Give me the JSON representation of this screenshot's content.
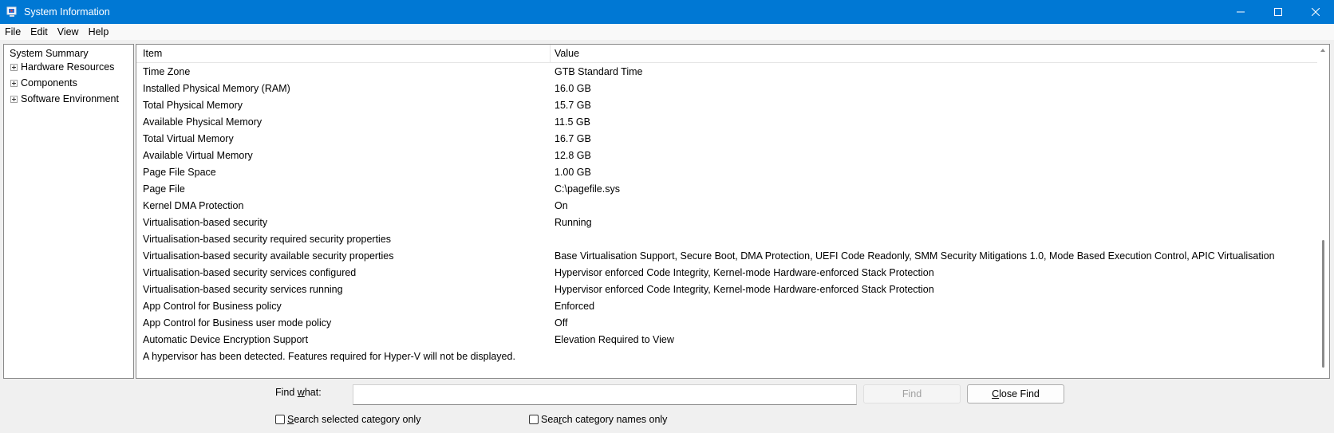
{
  "window": {
    "title": "System Information",
    "controls": {
      "minimize": "—",
      "maximize": "☐",
      "close": "✕"
    }
  },
  "menu": [
    "File",
    "Edit",
    "View",
    "Help"
  ],
  "tree": {
    "root": "System Summary",
    "nodes": [
      "Hardware Resources",
      "Components",
      "Software Environment"
    ]
  },
  "list": {
    "columns": {
      "item": "Item",
      "value": "Value"
    },
    "rows": [
      {
        "item": "Time Zone",
        "value": "GTB Standard Time"
      },
      {
        "item": "Installed Physical Memory (RAM)",
        "value": "16.0 GB"
      },
      {
        "item": "Total Physical Memory",
        "value": "15.7 GB"
      },
      {
        "item": "Available Physical Memory",
        "value": "11.5 GB"
      },
      {
        "item": "Total Virtual Memory",
        "value": "16.7 GB"
      },
      {
        "item": "Available Virtual Memory",
        "value": "12.8 GB"
      },
      {
        "item": "Page File Space",
        "value": "1.00 GB"
      },
      {
        "item": "Page File",
        "value": "C:\\pagefile.sys"
      },
      {
        "item": "Kernel DMA Protection",
        "value": "On"
      },
      {
        "item": "Virtualisation-based security",
        "value": "Running"
      },
      {
        "item": "Virtualisation-based security required security properties",
        "value": ""
      },
      {
        "item": "Virtualisation-based security available security properties",
        "value": "Base Virtualisation Support, Secure Boot, DMA Protection, UEFI Code Readonly, SMM Security Mitigations 1.0, Mode Based Execution Control, APIC Virtualisation"
      },
      {
        "item": "Virtualisation-based security services configured",
        "value": "Hypervisor enforced Code Integrity, Kernel-mode Hardware-enforced Stack Protection"
      },
      {
        "item": "Virtualisation-based security services running",
        "value": "Hypervisor enforced Code Integrity, Kernel-mode Hardware-enforced Stack Protection"
      },
      {
        "item": "App Control for Business policy",
        "value": "Enforced"
      },
      {
        "item": "App Control for Business user mode policy",
        "value": "Off"
      },
      {
        "item": "Automatic Device Encryption Support",
        "value": "Elevation Required to View"
      }
    ],
    "note": "A hypervisor has been detected. Features required for Hyper-V will not be displayed."
  },
  "find": {
    "label_pre": "Find ",
    "label_ul": "w",
    "label_post": "hat:",
    "input_value": "",
    "find_button": "Find",
    "close_button_ul": "C",
    "close_button_rest": "lose Find",
    "search_selected_ul": "S",
    "search_selected_rest": "earch selected category only",
    "search_names_pre": "Sea",
    "search_names_ul": "r",
    "search_names_rest": "ch category names only"
  },
  "colors": {
    "titlebar": "#0078d4",
    "background": "#f0f0f0"
  },
  "icons": {
    "app": "system-information-icon"
  }
}
